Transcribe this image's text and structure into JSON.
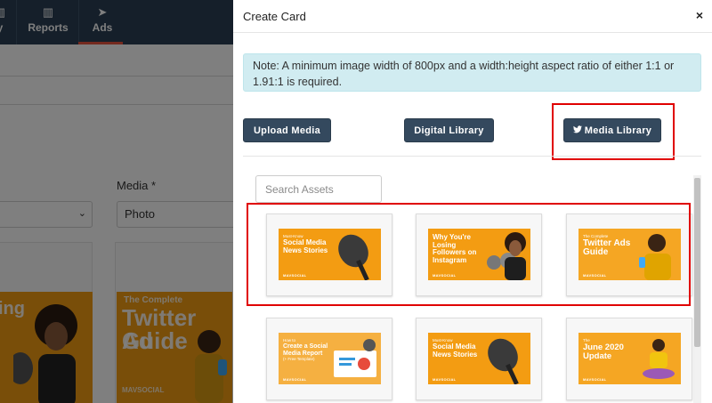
{
  "background_app": {
    "nav": [
      {
        "label": "y",
        "icon": "bar-chart-icon"
      },
      {
        "label": "Reports",
        "icon": "bar-chart-icon"
      },
      {
        "label": "Ads",
        "icon": "paper-plane-icon"
      }
    ],
    "media_label": "Media *",
    "media_value": "Photo",
    "thumb_texts": [
      "ing",
      "The Complete",
      "Twitter Ad",
      "Guide",
      "MAVSOCIAL"
    ]
  },
  "modal": {
    "title": "Create Card",
    "close_symbol": "×",
    "note": "Note: A minimum image width of 800px and a width:height aspect ratio of either 1:1 or 1.91:1 is required.",
    "buttons": {
      "upload": "Upload Media",
      "digital": "Digital Library",
      "media_library": "Media Library",
      "media_library_icon": "twitter-bird-icon"
    },
    "search_placeholder": "Search Assets",
    "assets": [
      {
        "small": "Must-Know",
        "title": "Social Media News Stories",
        "logo": "MAVSOCIAL"
      },
      {
        "small": "",
        "title": "Why You're Losing Followers on Instagram",
        "logo": "MAVSOCIAL"
      },
      {
        "small": "The Complete",
        "title": "Twitter Ads Guide",
        "logo": "MAVSOCIAL"
      },
      {
        "small": "How to",
        "title": "Create a Social Media Report",
        "small2": "(+ Free Template)",
        "logo": "MAVSOCIAL"
      },
      {
        "small": "Must-Know",
        "title": "Social Media News Stories",
        "logo": "MAVSOCIAL"
      },
      {
        "small": "The",
        "title": "June 2020 Update",
        "logo": "MAVSOCIAL"
      }
    ]
  },
  "colors": {
    "navy": "#2b3f54",
    "button": "#34495e",
    "highlight": "#e00000",
    "note_bg": "#d1ecf1",
    "asset_orange": "#f39c12"
  }
}
